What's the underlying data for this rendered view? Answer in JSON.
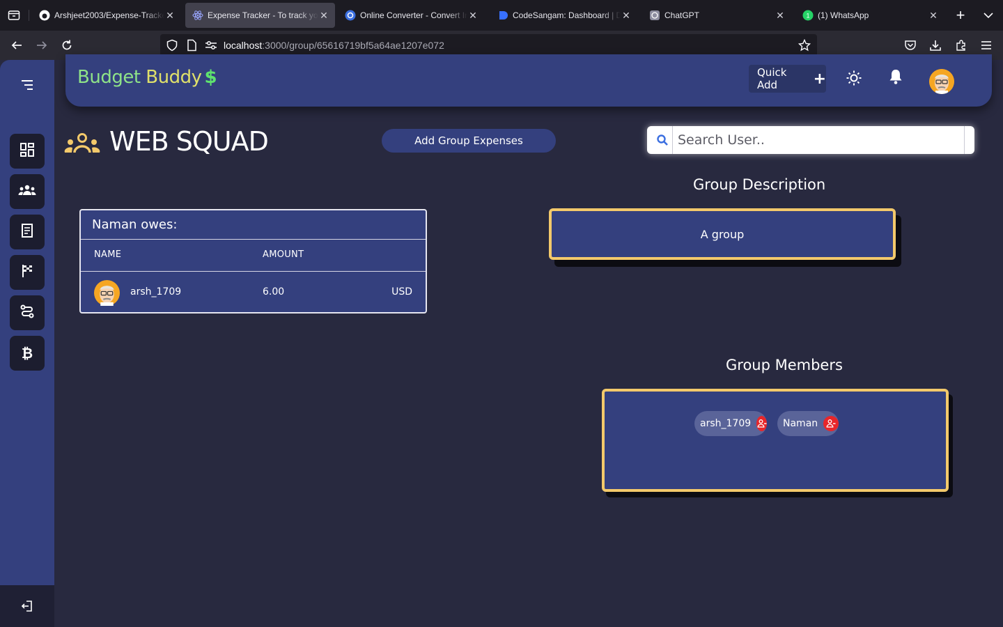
{
  "browser": {
    "tabs": [
      {
        "title": "Arshjeet2003/Expense-Tracker",
        "favicon": "github-icon",
        "active": false
      },
      {
        "title": "Expense Tracker - To track your",
        "favicon": "react-icon",
        "active": true
      },
      {
        "title": "Online Converter - Convert Image",
        "favicon": "converter-icon",
        "active": false
      },
      {
        "title": "CodeSangam: Dashboard | Devfolio",
        "favicon": "devfolio-icon",
        "active": false
      },
      {
        "title": "ChatGPT",
        "favicon": "openai-icon",
        "active": false
      },
      {
        "title": "(1) WhatsApp",
        "favicon": "whatsapp-icon",
        "active": false
      }
    ],
    "url_host": "localhost",
    "url_rest": ":3000/group/65616719bf5a64ae1207e072"
  },
  "app": {
    "brand_part1": "Budget",
    "brand_part2": "Buddy",
    "brand_symbol": "$",
    "quick_add_label": "Quick Add",
    "colors": {
      "accent": "#34407e",
      "background": "#28293f",
      "highlight_border": "#f3c96b",
      "remove": "#e8262a"
    }
  },
  "group": {
    "name": "WEB SQUAD",
    "add_expenses_label": "Add Group Expenses",
    "search_placeholder": "Search User..",
    "owes": {
      "title": "Naman owes:",
      "col_name": "NAME",
      "col_amount": "AMOUNT",
      "rows": [
        {
          "name": "arsh_1709",
          "amount": "6.00",
          "currency": "USD"
        }
      ]
    },
    "description_title": "Group Description",
    "description": "A group",
    "members_title": "Group Members",
    "members": [
      "arsh_1709",
      "Naman"
    ]
  }
}
